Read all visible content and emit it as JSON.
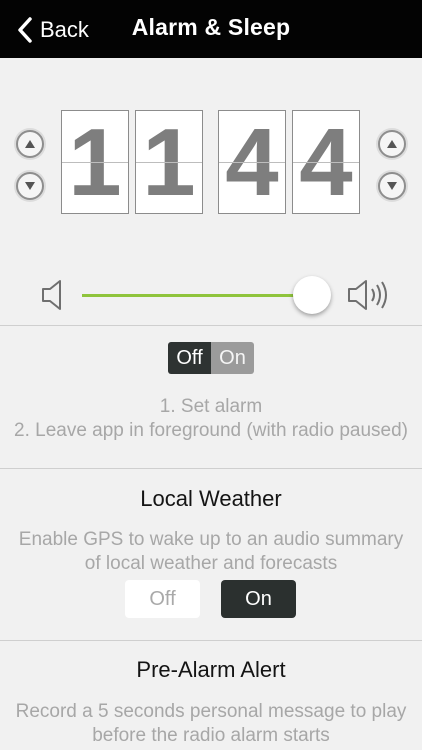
{
  "nav": {
    "back_label": "Back",
    "title": "Alarm & Sleep"
  },
  "alarm_time": {
    "hour_tens": "1",
    "hour_ones": "1",
    "minute_tens": "4",
    "minute_ones": "4"
  },
  "volume": {
    "level_fraction": 0.83
  },
  "sleep_mode": {
    "toggle_off": "Off",
    "toggle_on": "On",
    "selected": "Off",
    "instruction_1": "1. Set alarm",
    "instruction_2": "2. Leave app in foreground (with radio paused)"
  },
  "local_weather": {
    "title": "Local Weather",
    "description_line1": "Enable GPS to wake up to an audio summary",
    "description_line2": "of local weather and forecasts",
    "off_label": "Off",
    "on_label": "On",
    "selected": "On"
  },
  "pre_alarm": {
    "title": "Pre-Alarm Alert",
    "description_line1": "Record a 5 seconds personal message to play",
    "description_line2": "before the radio alarm starts"
  },
  "colors": {
    "navbar": "#030303",
    "background": "#f1f1f1",
    "slider_accent": "#8fc43c",
    "dark_toggle": "#2e3332"
  }
}
